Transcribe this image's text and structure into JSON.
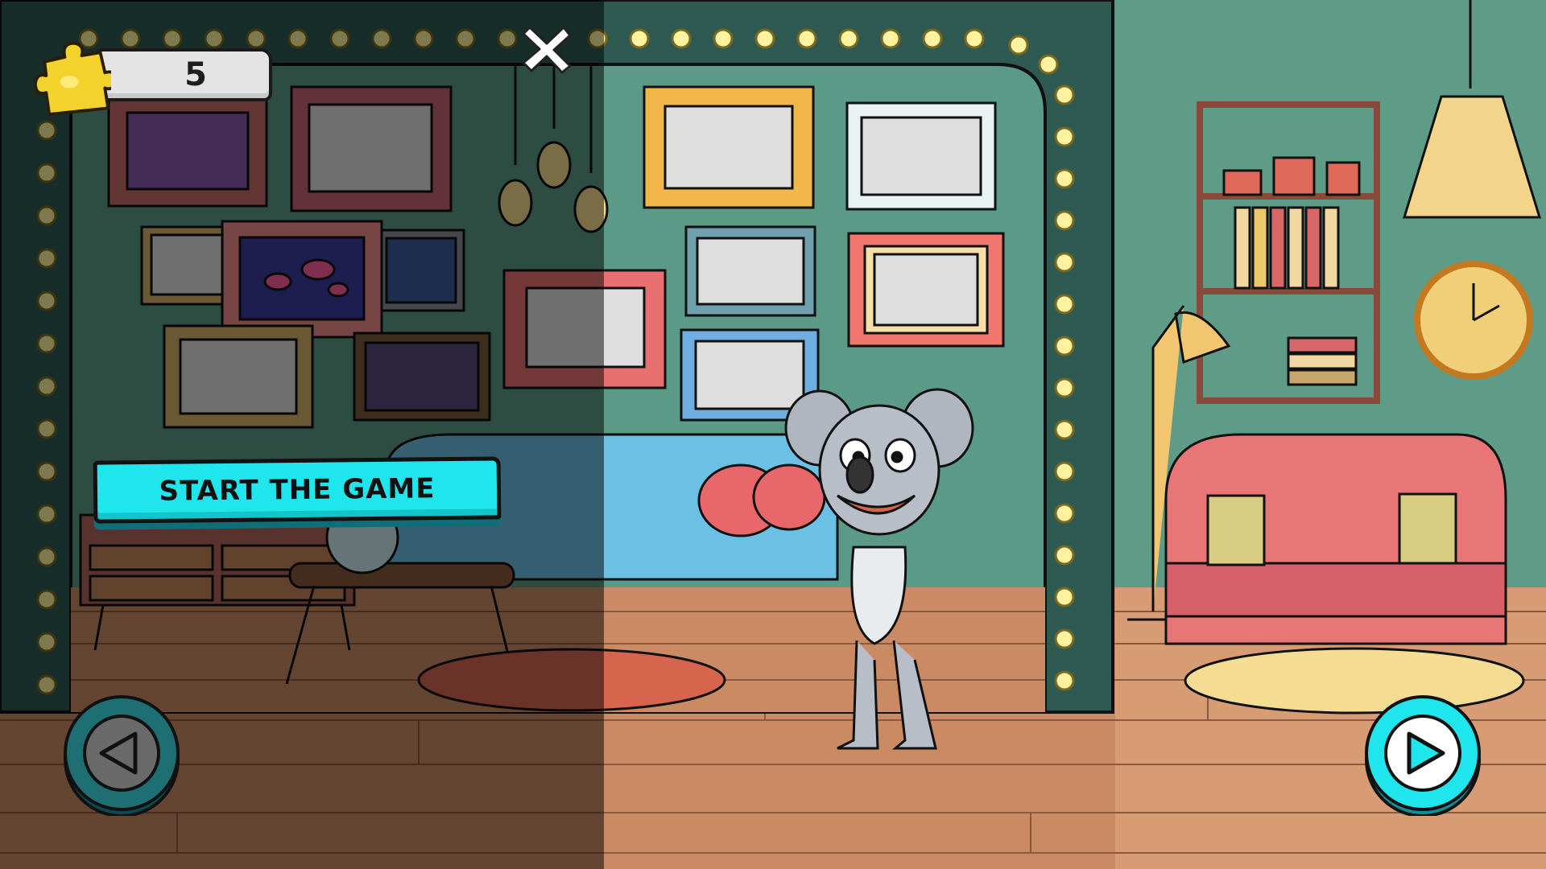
{
  "hud": {
    "puzzle_pieces": "5",
    "start_label": "START THE GAME"
  },
  "icons": {
    "puzzle": "puzzle-piece-icon",
    "close": "close-icon",
    "prev": "play-left-icon",
    "next": "play-right-icon"
  },
  "colors": {
    "accent": "#1fe6ec",
    "wall_left": "#2f5a52",
    "wall_right": "#5a9a86",
    "floor": "#c98a64",
    "bulb": "#fff2a0"
  }
}
